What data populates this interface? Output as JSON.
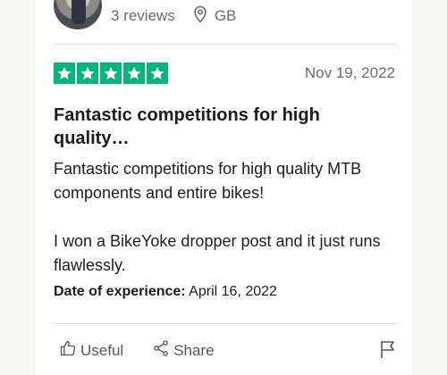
{
  "reviewer": {
    "reviews_count": "3 reviews",
    "country": "GB"
  },
  "review": {
    "rating": 5,
    "date": "Nov 19, 2022",
    "title": "Fantastic competitions for high quality…",
    "body": [
      "Fantastic competitions for high quality MTB components and entire bikes!",
      "I won a BikeYoke dropper post and it just runs flawlessly."
    ],
    "experience_label": "Date of experience:",
    "experience_date": "April 16, 2022"
  },
  "actions": {
    "useful_label": "Useful",
    "share_label": "Share"
  },
  "colors": {
    "star_green": "#00b67a",
    "muted_text": "#6b6b6b"
  },
  "icons": [
    "avatar",
    "location-pin-icon",
    "star-icon",
    "thumbs-up-icon",
    "share-icon",
    "flag-icon"
  ]
}
